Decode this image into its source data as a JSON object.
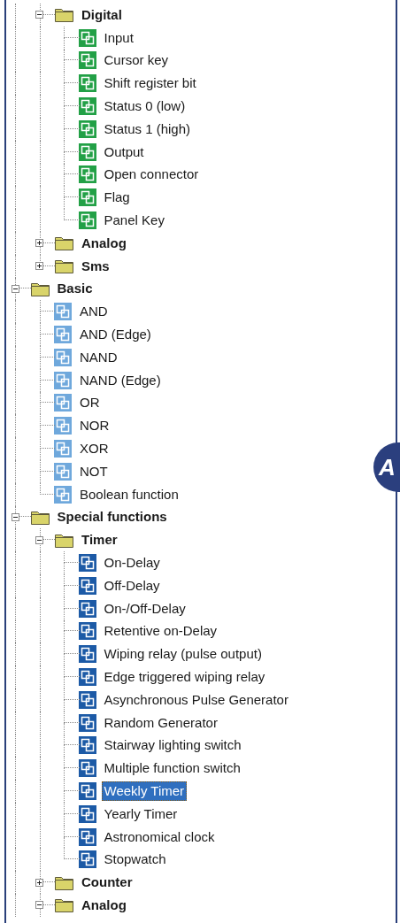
{
  "tree": {
    "items": [
      {
        "kind": "offscreen-parent",
        "children": [
          {
            "kind": "folder",
            "label": "Digital",
            "expanded": true,
            "selected": false,
            "children": [
              {
                "kind": "block",
                "label": "Input",
                "color": "#22a046",
                "selected": false
              },
              {
                "kind": "block",
                "label": "Cursor key",
                "color": "#22a046",
                "selected": false
              },
              {
                "kind": "block",
                "label": "Shift register bit",
                "color": "#22a046",
                "selected": false
              },
              {
                "kind": "block",
                "label": "Status 0 (low)",
                "color": "#22a046",
                "selected": false
              },
              {
                "kind": "block",
                "label": "Status 1 (high)",
                "color": "#22a046",
                "selected": false
              },
              {
                "kind": "block",
                "label": "Output",
                "color": "#22a046",
                "selected": false
              },
              {
                "kind": "block",
                "label": "Open connector",
                "color": "#22a046",
                "selected": false
              },
              {
                "kind": "block",
                "label": "Flag",
                "color": "#22a046",
                "selected": false
              },
              {
                "kind": "block",
                "label": "Panel Key",
                "color": "#22a046",
                "selected": false
              }
            ]
          },
          {
            "kind": "folder",
            "label": "Analog",
            "expanded": false,
            "selected": false
          },
          {
            "kind": "folder",
            "label": "Sms",
            "expanded": false,
            "selected": false
          }
        ]
      },
      {
        "kind": "folder",
        "label": "Basic",
        "expanded": true,
        "selected": false,
        "children": [
          {
            "kind": "block",
            "label": "AND",
            "color": "#6fa8dc",
            "selected": false
          },
          {
            "kind": "block",
            "label": "AND (Edge)",
            "color": "#6fa8dc",
            "selected": false
          },
          {
            "kind": "block",
            "label": "NAND",
            "color": "#6fa8dc",
            "selected": false
          },
          {
            "kind": "block",
            "label": "NAND (Edge)",
            "color": "#6fa8dc",
            "selected": false
          },
          {
            "kind": "block",
            "label": "OR",
            "color": "#6fa8dc",
            "selected": false
          },
          {
            "kind": "block",
            "label": "NOR",
            "color": "#6fa8dc",
            "selected": false
          },
          {
            "kind": "block",
            "label": "XOR",
            "color": "#6fa8dc",
            "selected": false
          },
          {
            "kind": "block",
            "label": "NOT",
            "color": "#6fa8dc",
            "selected": false
          },
          {
            "kind": "block",
            "label": "Boolean function",
            "color": "#6fa8dc",
            "selected": false
          }
        ]
      },
      {
        "kind": "folder",
        "label": "Special functions",
        "expanded": true,
        "selected": false,
        "children": [
          {
            "kind": "folder",
            "label": "Timer",
            "expanded": true,
            "selected": false,
            "children": [
              {
                "kind": "block",
                "label": "On-Delay",
                "color": "#1c5aa6",
                "selected": false
              },
              {
                "kind": "block",
                "label": "Off-Delay",
                "color": "#1c5aa6",
                "selected": false
              },
              {
                "kind": "block",
                "label": "On-/Off-Delay",
                "color": "#1c5aa6",
                "selected": false
              },
              {
                "kind": "block",
                "label": "Retentive on-Delay",
                "color": "#1c5aa6",
                "selected": false
              },
              {
                "kind": "block",
                "label": "Wiping relay (pulse output)",
                "color": "#1c5aa6",
                "selected": false
              },
              {
                "kind": "block",
                "label": "Edge triggered wiping relay",
                "color": "#1c5aa6",
                "selected": false
              },
              {
                "kind": "block",
                "label": "Asynchronous Pulse Generator",
                "color": "#1c5aa6",
                "selected": false
              },
              {
                "kind": "block",
                "label": "Random Generator",
                "color": "#1c5aa6",
                "selected": false
              },
              {
                "kind": "block",
                "label": "Stairway lighting switch",
                "color": "#1c5aa6",
                "selected": false
              },
              {
                "kind": "block",
                "label": "Multiple function switch",
                "color": "#1c5aa6",
                "selected": false
              },
              {
                "kind": "block",
                "label": "Weekly Timer",
                "color": "#1c5aa6",
                "selected": true
              },
              {
                "kind": "block",
                "label": "Yearly Timer",
                "color": "#1c5aa6",
                "selected": false
              },
              {
                "kind": "block",
                "label": "Astronomical clock",
                "color": "#1c5aa6",
                "selected": false
              },
              {
                "kind": "block",
                "label": "Stopwatch",
                "color": "#1c5aa6",
                "selected": false
              }
            ]
          },
          {
            "kind": "folder",
            "label": "Counter",
            "expanded": false,
            "selected": false
          },
          {
            "kind": "folder",
            "label": "Analog",
            "expanded": true,
            "selected": false
          }
        ]
      }
    ]
  },
  "badge": {
    "text": "A"
  }
}
